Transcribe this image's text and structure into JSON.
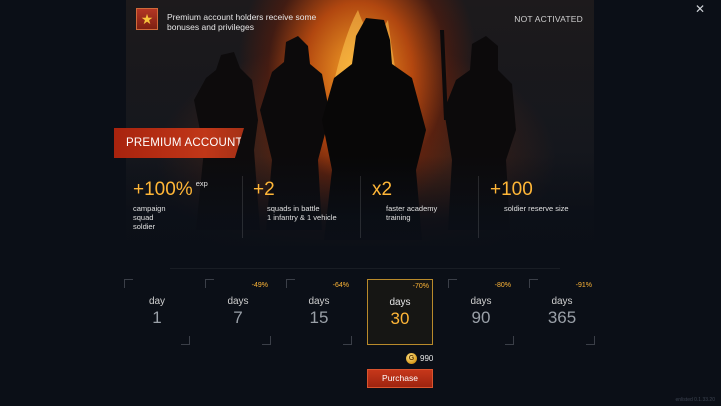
{
  "header": {
    "description": "Premium account holders receive some bonuses and privileges",
    "status": "NOT ACTIVATED",
    "close_icon": "close-icon",
    "badge_icon": "star-icon"
  },
  "banner": {
    "title": "PREMIUM ACCOUNT"
  },
  "bonuses": [
    {
      "value": "+100%",
      "sup": "exp",
      "label": "campaign\nsquad\nsoldier"
    },
    {
      "value": "+2",
      "sup": "",
      "label": "squads in battle\n1 infantry & 1 vehicle"
    },
    {
      "value": "x2",
      "sup": "",
      "label": "faster academy\ntraining"
    },
    {
      "value": "+100",
      "sup": "",
      "label": "soldier reserve size"
    }
  ],
  "durations": [
    {
      "unit": "day",
      "value": "1",
      "discount": ""
    },
    {
      "unit": "days",
      "value": "7",
      "discount": "-49%"
    },
    {
      "unit": "days",
      "value": "15",
      "discount": "-64%"
    },
    {
      "unit": "days",
      "value": "30",
      "discount": "-70%",
      "selected": true
    },
    {
      "unit": "days",
      "value": "90",
      "discount": "-80%"
    },
    {
      "unit": "days",
      "value": "365",
      "discount": "-91%"
    }
  ],
  "price": {
    "amount": "990",
    "currency_icon": "gold-coin-icon"
  },
  "purchase_label": "Purchase",
  "version": "enlisted 0.1.33.20",
  "colors": {
    "accent": "#ffb637",
    "banner": "#b32b13",
    "background": "#0b0f17"
  }
}
